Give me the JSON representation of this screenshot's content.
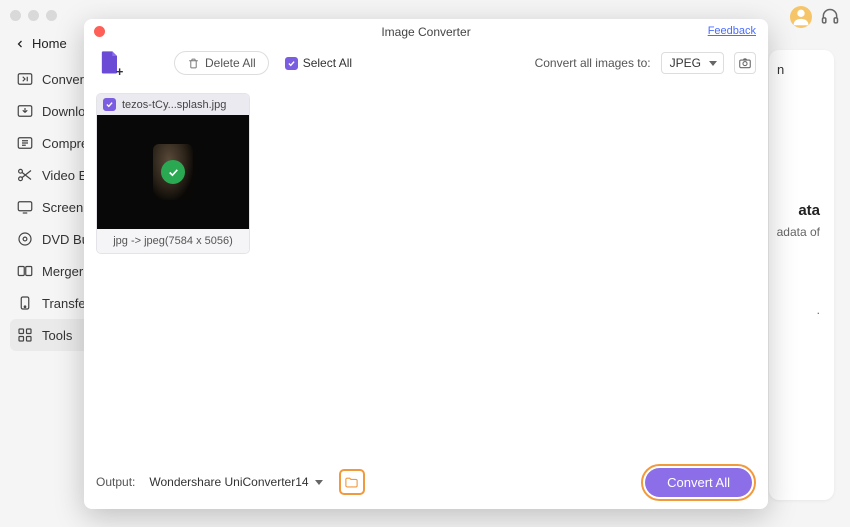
{
  "window": {
    "colors": {
      "accent": "#8c6fe8",
      "highlight": "#f19a3d"
    }
  },
  "sidebar": {
    "home_label": "Home",
    "items": [
      {
        "label": "Conver"
      },
      {
        "label": "Downlo"
      },
      {
        "label": "Compre"
      },
      {
        "label": "Video E"
      },
      {
        "label": "Screen"
      },
      {
        "label": "DVD Bu"
      },
      {
        "label": "Merger"
      },
      {
        "label": "Transfe"
      },
      {
        "label": "Tools"
      }
    ]
  },
  "background": {
    "snippet_n": "n",
    "snippet_ata": "ata",
    "snippet_line2": "adata of",
    "snippet_line3": "."
  },
  "modal": {
    "title": "Image Converter",
    "feedback_label": "Feedback",
    "toolbar": {
      "delete_all_label": "Delete All",
      "select_all_label": "Select All",
      "convert_to_label": "Convert all images to:",
      "format_selected": "JPEG"
    },
    "item": {
      "filename": "tezos-tCy...splash.jpg",
      "footer": "jpg -> jpeg(7584 x 5056)",
      "checked": true
    },
    "output": {
      "label": "Output:",
      "path": "Wondershare UniConverter14"
    },
    "convert_all_label": "Convert All"
  }
}
